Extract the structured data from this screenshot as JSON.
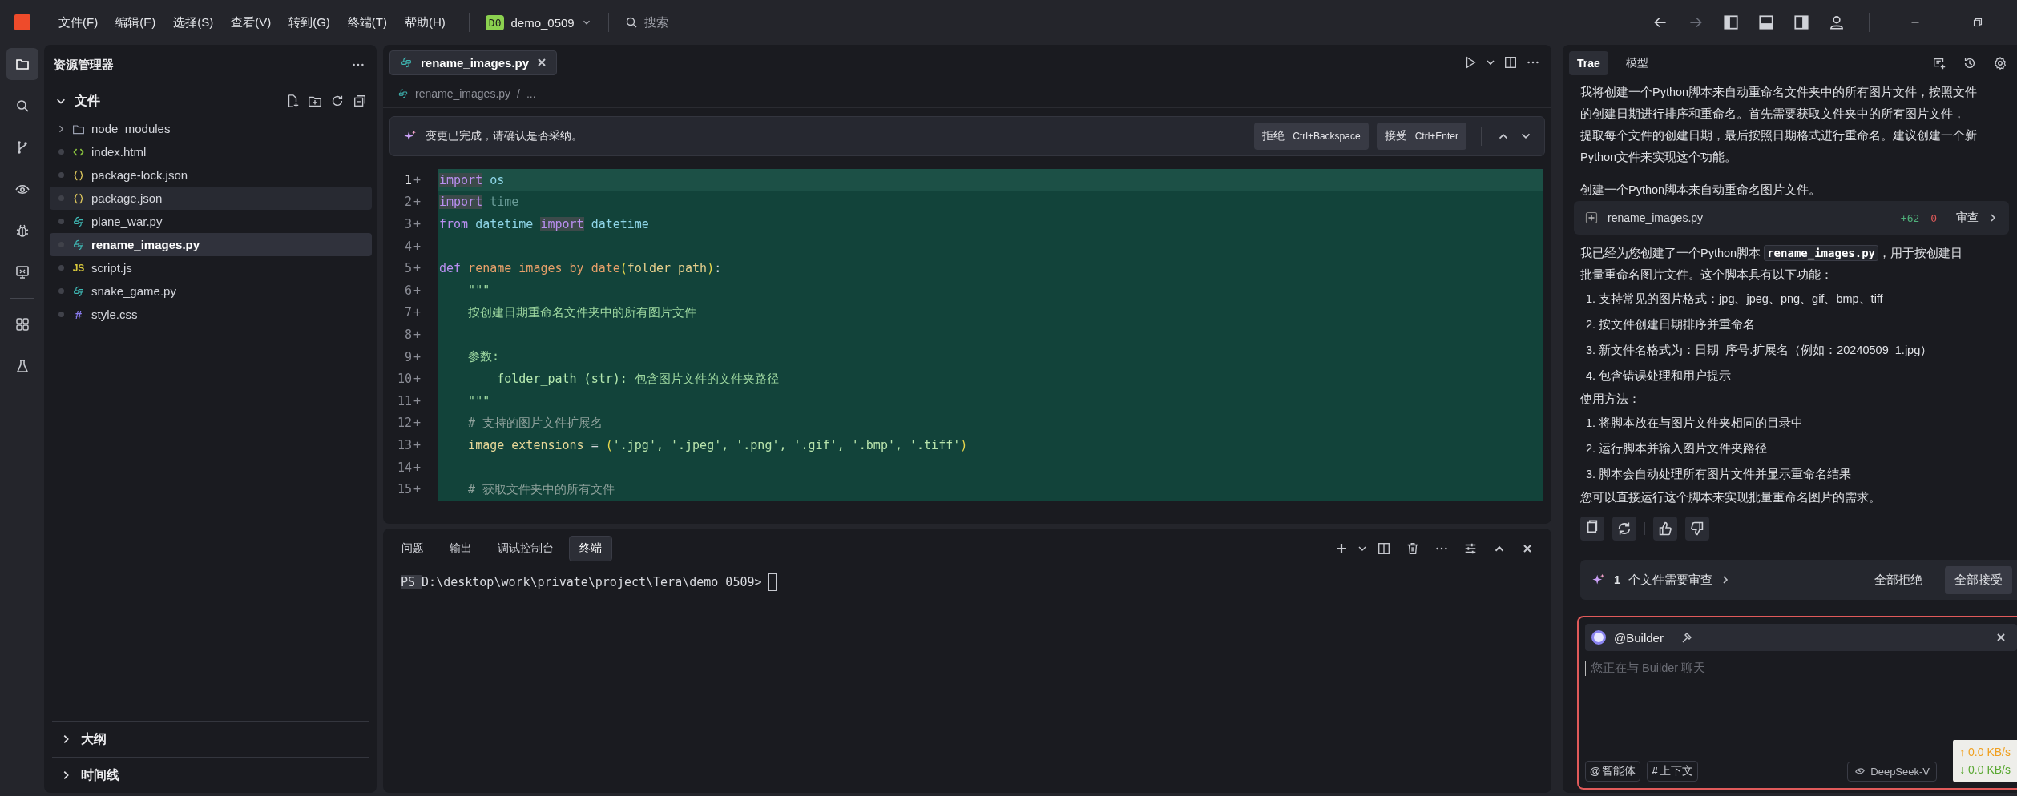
{
  "menu": [
    "文件(F)",
    "编辑(E)",
    "选择(S)",
    "查看(V)",
    "转到(G)",
    "终端(T)",
    "帮助(H)"
  ],
  "project": {
    "badge": "D0",
    "name": "demo_0509"
  },
  "search": {
    "placeholder": "搜索"
  },
  "activity_bar": [
    {
      "kind": "files",
      "selected": true
    },
    {
      "kind": "search",
      "selected": false
    },
    {
      "kind": "git",
      "selected": false
    },
    {
      "kind": "eye",
      "selected": false
    },
    {
      "kind": "bug",
      "selected": false
    },
    {
      "kind": "remote",
      "selected": false
    },
    {
      "kind": "extensions",
      "selected": false
    },
    {
      "kind": "flask",
      "selected": false
    }
  ],
  "explorer": {
    "title": "资源管理器",
    "section": "文件",
    "expanded": true,
    "items": [
      {
        "name": "node_modules",
        "kind": "folder",
        "selected": false,
        "hovered": false
      },
      {
        "name": "index.html",
        "kind": "html",
        "selected": false,
        "hovered": false
      },
      {
        "name": "package-lock.json",
        "kind": "json",
        "selected": false,
        "hovered": false
      },
      {
        "name": "package.json",
        "kind": "json",
        "selected": false,
        "hovered": true
      },
      {
        "name": "plane_war.py",
        "kind": "python",
        "selected": false,
        "hovered": false
      },
      {
        "name": "rename_images.py",
        "kind": "python",
        "selected": true,
        "hovered": false
      },
      {
        "name": "script.js",
        "kind": "js",
        "badge": "JS",
        "selected": false,
        "hovered": false
      },
      {
        "name": "snake_game.py",
        "kind": "python",
        "selected": false,
        "hovered": false
      },
      {
        "name": "style.css",
        "kind": "css",
        "badge": "#",
        "selected": false,
        "hovered": false
      }
    ],
    "sections": [
      {
        "title": "大纲",
        "expanded": false
      },
      {
        "title": "时间线",
        "expanded": false
      }
    ]
  },
  "editor": {
    "tabs": [
      {
        "label": "rename_images.py",
        "selected": true
      }
    ],
    "breadcrumb": {
      "file": "rename_images.py",
      "separator": "/",
      "rest": "..."
    },
    "diff_bar": {
      "message": "变更已完成，请确认是否采纳。",
      "buttons": [
        {
          "label": "拒绝",
          "shortcut": "Ctrl+Backspace"
        },
        {
          "label": "接受",
          "shortcut": "Ctrl+Enter"
        }
      ]
    },
    "lines": [
      {
        "number": "1",
        "marker": "+",
        "selected": true,
        "tokens": [
          {
            "kind": "match",
            "text": "import"
          },
          {
            "kind": "module",
            "text": " os"
          }
        ]
      },
      {
        "number": "2",
        "marker": "+",
        "selected": false,
        "tokens": [
          {
            "kind": "match",
            "text": "import"
          },
          {
            "kind": "unused",
            "text": " time"
          }
        ]
      },
      {
        "number": "3",
        "marker": "+",
        "selected": false,
        "tokens": [
          {
            "kind": "keyword",
            "text": "from"
          },
          {
            "kind": "module",
            "text": " datetime "
          },
          {
            "kind": "match",
            "text": "import"
          },
          {
            "kind": "module",
            "text": " datetime"
          }
        ]
      },
      {
        "number": "4",
        "marker": "+",
        "selected": false
      },
      {
        "number": "5",
        "marker": "+",
        "selected": false,
        "tokens": [
          {
            "kind": "keyword",
            "text": "def"
          },
          {
            "kind": "func",
            "text": " rename_images_by_date"
          },
          {
            "kind": "paren",
            "text": "("
          },
          {
            "kind": "param",
            "text": "folder_path"
          },
          {
            "kind": "paren",
            "text": ")"
          },
          {
            "kind": "plain",
            "text": ":"
          }
        ]
      },
      {
        "number": "6",
        "marker": "+",
        "selected": false,
        "tokens": [
          {
            "kind": "doc",
            "text": "    \"\"\""
          }
        ]
      },
      {
        "number": "7",
        "marker": "+",
        "selected": false,
        "tokens": [
          {
            "kind": "doc",
            "text": "    按创建日期重命名文件夹中的所有图片文件"
          }
        ]
      },
      {
        "number": "8",
        "marker": "+",
        "selected": false
      },
      {
        "number": "9",
        "marker": "+",
        "selected": false,
        "tokens": [
          {
            "kind": "doc",
            "text": "    参数:"
          }
        ]
      },
      {
        "number": "10",
        "marker": "+",
        "selected": false,
        "tokens": [
          {
            "kind": "docparam",
            "text": "        folder_path (str):"
          },
          {
            "kind": "doc",
            "text": " 包含图片文件的文件夹路径"
          }
        ]
      },
      {
        "number": "11",
        "marker": "+",
        "selected": false,
        "tokens": [
          {
            "kind": "doc",
            "text": "    \"\"\""
          }
        ]
      },
      {
        "number": "12",
        "marker": "+",
        "selected": false,
        "tokens": [
          {
            "kind": "comment",
            "text": "    # 支持的图片文件扩展名"
          }
        ]
      },
      {
        "number": "13",
        "marker": "+",
        "selected": false,
        "tokens": [
          {
            "kind": "var",
            "text": "    image_extensions"
          },
          {
            "kind": "plain",
            "text": " = "
          },
          {
            "kind": "paren",
            "text": "("
          },
          {
            "kind": "string",
            "text": "'.jpg', '.jpeg', '.png', '.gif', '.bmp', '.tiff'"
          },
          {
            "kind": "paren",
            "text": ")"
          }
        ]
      },
      {
        "number": "14",
        "marker": "+",
        "selected": false
      },
      {
        "number": "15",
        "marker": "+",
        "selected": false,
        "tokens": [
          {
            "kind": "comment",
            "text": "    # 获取文件夹中的所有文件"
          }
        ]
      }
    ]
  },
  "terminal": {
    "tabs": [
      {
        "label": "问题",
        "selected": false
      },
      {
        "label": "输出",
        "selected": false
      },
      {
        "label": "调试控制台",
        "selected": false
      },
      {
        "label": "终端",
        "selected": true
      }
    ],
    "prompt": {
      "prefix": "PS",
      "path": "D:\\desktop\\work\\private\\project\\Tera\\demo_0509>"
    }
  },
  "chat": {
    "tabs": [
      {
        "label": "Trae",
        "selected": true
      },
      {
        "label": "模型",
        "selected": false
      }
    ],
    "blocks": [
      {
        "kind": "lines",
        "lines": [
          "我将创建一个Python脚本来自动重命名文件夹中的所有图片文件，按照文件",
          "的创建日期进行排序和重命名。首先需要获取文件夹中的所有图片文件，",
          "提取每个文件的创建日期，最后按照日期格式进行重命名。建议创建一个新",
          "Python文件来实现这个功能。"
        ]
      },
      {
        "kind": "text",
        "text": "创建一个Python脚本来自动重命名图片文件。"
      },
      {
        "kind": "file",
        "name": "rename_images.py",
        "added": "+62",
        "removed": "-0",
        "action": "审查"
      },
      {
        "kind": "code_line",
        "before": "我已经为您创建了一个Python脚本",
        "code": "rename_images.py",
        "after": "，用于按创建日"
      },
      {
        "kind": "text",
        "text": "批量重命名图片文件。这个脚本具有以下功能："
      },
      {
        "kind": "list",
        "items": [
          {
            "number": "1.",
            "text": "支持常见的图片格式：jpg、jpeg、png、gif、bmp、tiff"
          },
          {
            "number": "2.",
            "text": "按文件创建日期排序并重命名"
          },
          {
            "number": "3.",
            "text": "新文件名格式为：日期_序号.扩展名（例如：20240509_1.jpg）"
          },
          {
            "number": "4.",
            "text": "包含错误处理和用户提示"
          }
        ]
      },
      {
        "kind": "text",
        "text": "使用方法："
      },
      {
        "kind": "list",
        "items": [
          {
            "number": "1.",
            "text": "将脚本放在与图片文件夹相同的目录中"
          },
          {
            "number": "2.",
            "text": "运行脚本并输入图片文件夹路径"
          },
          {
            "number": "3.",
            "text": "脚本会自动处理所有图片文件并显示重命名结果"
          }
        ]
      },
      {
        "kind": "text",
        "text": "您可以直接运行这个脚本来实现批量重命名图片的需求。"
      }
    ],
    "review": {
      "count": "1",
      "text": "个文件需要审查",
      "reject_all": "全部拒绝",
      "accept_all": "全部接受"
    },
    "input": {
      "agent": "@Builder",
      "placeholder": "您正在与 Builder 聊天",
      "chips": [
        {
          "symbol": "@",
          "label": "智能体"
        },
        {
          "symbol": "#",
          "label": "上下文"
        }
      ],
      "model": "DeepSeek-V"
    }
  },
  "net_speed": {
    "upload": "↑ 0.0 KB/s",
    "download": "↓ 0.0 KB/s"
  }
}
